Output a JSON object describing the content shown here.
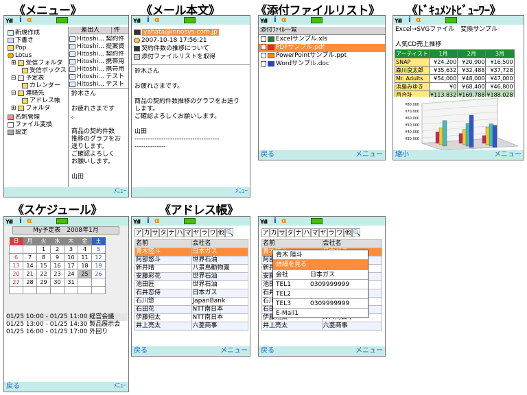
{
  "status": {
    "signal": "Yıll",
    "imode": "i",
    "alarm": "α"
  },
  "titles": {
    "menu": "《メニュー》",
    "mail": "《メール本文》",
    "attach": "《添付ファイルリスト》",
    "doc": "《ﾄﾞｷｭﾒﾝﾄﾋﾞｭｰﾜｰ》",
    "sched": "《スケジュール》",
    "addr": "《アドレス帳》"
  },
  "softkeys": {
    "back": "戻る",
    "menu": "メニュー",
    "menu_small": "ﾒﾆｭｰ",
    "shrink": "縮小"
  },
  "menu": {
    "tree": [
      "新規作成",
      "下書き",
      "Pop",
      "Lotus",
      "受信フォルダ",
      "受信ボックス",
      "予定表",
      "カレンダー",
      "連絡先",
      "アドレス帳",
      "フォルダ",
      "名刺管理",
      "ファイル変換",
      "設定"
    ],
    "cols": [
      "差出人",
      "件"
    ],
    "mails": [
      {
        "from": "Hitoshi…",
        "subj": "契約件"
      },
      {
        "from": "Hitoshi…",
        "subj": "提案資"
      },
      {
        "from": "Hitoshi…",
        "subj": "契約件"
      },
      {
        "from": "Hitoshi…",
        "subj": "携帯用"
      },
      {
        "from": "Hitoshi…",
        "subj": "携帯用"
      },
      {
        "from": "Hitoshi…",
        "subj": "テスト"
      },
      {
        "from": "Hitoshi…",
        "subj": "テスト"
      }
    ],
    "preview": [
      "鈴木さん",
      "",
      "お疲れさまです",
      "。",
      "",
      "商品の契約件数",
      "推移のグラフをお",
      "送りします。",
      "ご確認よろしく",
      "お願いします。",
      "",
      "山田"
    ]
  },
  "mail": {
    "from": "yahata@innosys-com.jp",
    "date": "2007-10-18 17:56:21",
    "subject": "契約件数の推移について",
    "attach": "添付ファイルリストを取得",
    "body": [
      "鈴木さん",
      "",
      "お疲れさまです。",
      "",
      "商品の契約件数推移のグラフをお送り",
      "します。",
      "ご確認よろしくお願いします。",
      "",
      "山田",
      "--------------------------------------",
      "--------------"
    ]
  },
  "attach": {
    "header": "添付ﾌｧｲﾙ一覧",
    "files": [
      "Excelサンプル.xls",
      "PDFサンプル.pdf",
      "PowerPointサンプル.ppt",
      "Wordサンプル.doc"
    ]
  },
  "doc": {
    "title": "Excel→SVGファイル　変換サンプル",
    "subtitle": "人気CD売上推移",
    "cols": [
      "アーティスト",
      "1月",
      "2月",
      "3月"
    ],
    "rows": [
      [
        "SNAP",
        "¥24,200",
        "¥20,900",
        "¥16,500"
      ],
      [
        "森川良太郎",
        "¥35,632",
        "¥32,488",
        "¥37,728"
      ],
      [
        "Mr. Adults",
        "¥54,000",
        "¥48,000",
        "¥47,000"
      ],
      [
        "浜島みゆき",
        "¥0",
        "¥68,400",
        "¥46,800"
      ],
      [
        "月合計",
        "¥113,832",
        "¥169,788",
        "¥188,028"
      ]
    ],
    "yticks": [
      "¥80,000",
      "¥70,000",
      "¥60,000",
      "¥50,000",
      "¥40,000",
      "¥30,000"
    ]
  },
  "sched": {
    "header": "My予定表　2008年1月",
    "days": [
      "日",
      "月",
      "火",
      "水",
      "木",
      "金",
      "土"
    ],
    "weeks": [
      [
        "",
        "",
        "1",
        "2",
        "3",
        "4",
        "5"
      ],
      [
        "6",
        "7",
        "8",
        "9",
        "10",
        "11",
        "12"
      ],
      [
        "13",
        "14",
        "15",
        "16",
        "17",
        "18",
        "19"
      ],
      [
        "20",
        "21",
        "22",
        "23",
        "24",
        "25",
        "26"
      ],
      [
        "27",
        "28",
        "29",
        "30",
        "31",
        "",
        ""
      ],
      [
        "",
        "",
        "",
        "",
        "",
        "",
        ""
      ]
    ],
    "events": [
      "01/25 10:00 - 01/25 11:00 経営会議",
      "01/25 13:00 - 01/25 14:30 製品展示会",
      "01/25 16:00 - 01/25 17:00 外回り"
    ]
  },
  "addr": {
    "kana": [
      "ア",
      "カ",
      "サ",
      "タ",
      "ナ",
      "ハ",
      "マ",
      "ヤ",
      "ラ",
      "ワ",
      "他"
    ],
    "cols": [
      "名前",
      "会社名"
    ],
    "rows": [
      [
        "青木陸斗",
        "日本ガス"
      ],
      [
        "阿部悠斗",
        "世界石油"
      ],
      [
        "新井晴",
        "八景島動物園"
      ],
      [
        "安藤彩花",
        "世界石油"
      ],
      [
        "池田匠",
        "世界石油"
      ],
      [
        "石井恋侍",
        "日本ガス"
      ],
      [
        "石川惣",
        "JapanBank"
      ],
      [
        "石田花",
        "NTT南日本"
      ],
      [
        "伊藤翔太",
        "NTT南日本"
      ],
      [
        "井上亮太",
        "六菱商事"
      ]
    ],
    "popup": {
      "name": "青木 陸斗",
      "detail": "詳細を見る",
      "fields": [
        [
          "会社",
          "日本ガス"
        ],
        [
          "TEL1",
          "0309999999"
        ],
        [
          "TEL2",
          ""
        ],
        [
          "TEL3",
          "0309999999"
        ],
        [
          "E-Mail1",
          ""
        ]
      ]
    }
  }
}
